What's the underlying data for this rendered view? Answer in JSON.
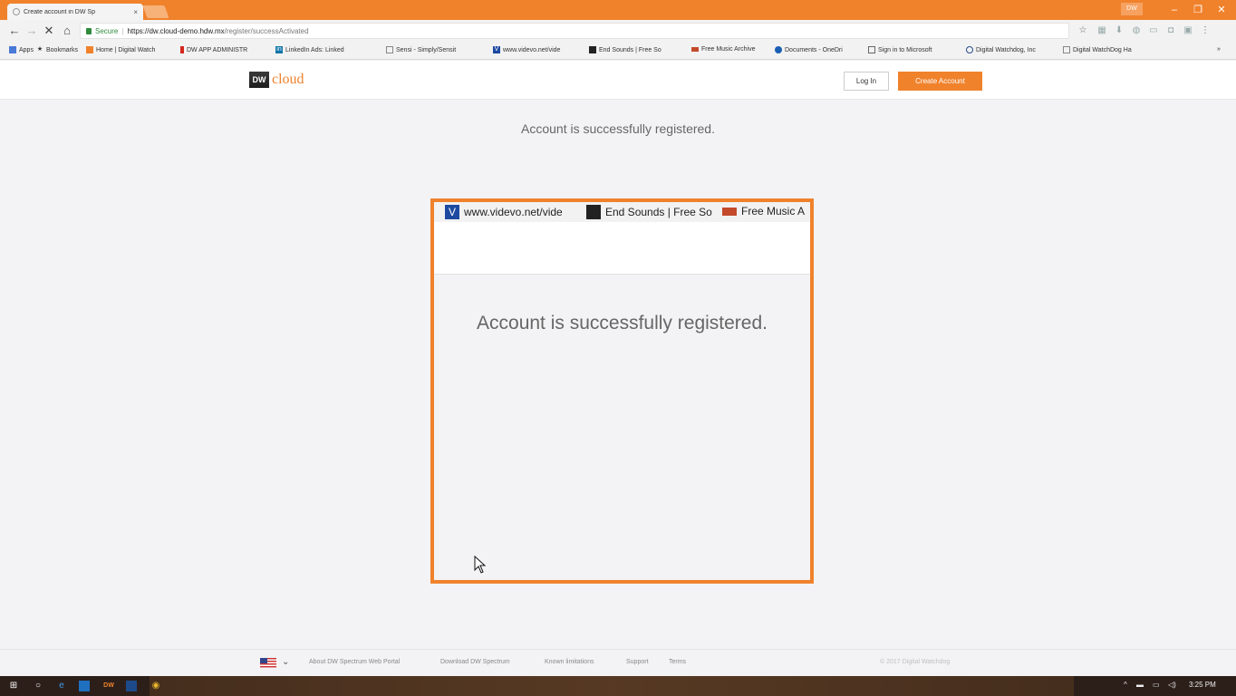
{
  "browser": {
    "tab_title": "Create account in DW Sp",
    "tab_close": "×",
    "user_chip": "DW",
    "window_controls": {
      "minimize": "–",
      "restore": "❐",
      "close": "✕"
    },
    "url_secure_label": "Secure",
    "url_main": "https://dw.cloud-demo.hdw.mx",
    "url_path": "/register/successActivated",
    "bookmarks": [
      {
        "icon": "apps-icon",
        "label": "Apps"
      },
      {
        "icon": "star-icon",
        "label": "Bookmarks"
      },
      {
        "icon": "dw-icon",
        "label": "Home | Digital Watch"
      },
      {
        "icon": "bars-icon",
        "label": "DW APP ADMINISTR"
      },
      {
        "icon": "linkedin-icon",
        "label": "LinkedIn Ads: Linked"
      },
      {
        "icon": "page-icon",
        "label": "Sensi - Simply/Sensit"
      },
      {
        "icon": "videvo-icon",
        "label": "www.videvo.net/vide"
      },
      {
        "icon": "endsounds-icon",
        "label": "End Sounds | Free So"
      },
      {
        "icon": "fma-icon",
        "label": "Free Music Archive"
      },
      {
        "icon": "onedrive-icon",
        "label": "Documents - OneDri"
      },
      {
        "icon": "microsoft-icon",
        "label": "Sign in to Microsoft"
      },
      {
        "icon": "dw-globe-icon",
        "label": "Digital Watchdog, Inc"
      },
      {
        "icon": "page-icon",
        "label": "Digital WatchDog Ha"
      }
    ],
    "bookmarks_overflow": "»"
  },
  "site": {
    "logo_badge": "DW",
    "logo_text": "cloud",
    "login_label": "Log In",
    "create_account_label": "Create Account",
    "success_message": "Account is successfully registered."
  },
  "zoom": {
    "bookmarks": [
      {
        "label": "www.videvo.net/vide"
      },
      {
        "label": "End Sounds | Free So"
      },
      {
        "label": "Free Music A"
      }
    ],
    "success_message": "Account is successfully registered."
  },
  "footer": {
    "links": [
      "About DW Spectrum Web Portal",
      "Download DW Spectrum",
      "Known limitations",
      "Support",
      "Terms"
    ],
    "copyright": "© 2017 Digital Watchdog"
  },
  "taskbar": {
    "time": "3:25 PM"
  },
  "colors": {
    "accent": "#f0822c",
    "text_muted": "#666666",
    "page_bg": "#f3f3f5"
  }
}
